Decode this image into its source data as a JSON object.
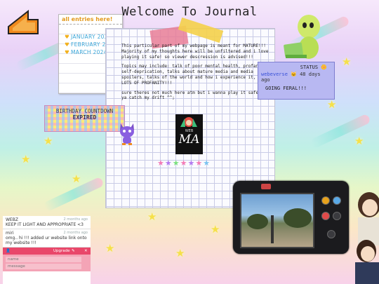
{
  "page": {
    "title": "Welcome To Journal"
  },
  "entries": {
    "heading": "all entries here!",
    "items": [
      "JANUARY 2024",
      "FEBRUARY 2024",
      "MARCH 2024"
    ]
  },
  "journal": {
    "paragraphs": [
      "This particular part of my webpage is meant for MATURE!!! Majority of my thoughts here will be unfiltered and i love playing it safe! so viewer descression is advised!!!",
      "Topics may include: talk of poor mental health, profanity, self-deprication, talks about mature media and media spoilers, talks of the world and how i experience it, and LOTS OF PROFANITY!!!",
      "sure theres not much here atm but i wanna play it safe if ya catch my drift ^^;"
    ]
  },
  "webma": {
    "small": "WEB",
    "big": "MA"
  },
  "birthday": {
    "line1": "BIRTHDAY COUNTDOWN",
    "line2": "EXPIRED"
  },
  "status": {
    "label": "STATUS",
    "user": "webeverse",
    "time": "48 days ago",
    "message": "GOING FERAL!!!"
  },
  "comments": {
    "items": [
      {
        "author": "WEBZ",
        "time": "2 months ago",
        "text": "KEEP IT LIGHT AND APPROPRIATE <3"
      },
      {
        "author": "miri",
        "time": "2 months ago",
        "text": "omg.. hi !!! added ur website link onto my website !!!"
      }
    ],
    "upgrade": "Upgrade",
    "name_placeholder": "name",
    "message_placeholder": "message"
  },
  "colors": {
    "status_bg": "#b8b8f2",
    "comment_bar": "#e9476a",
    "entry_link": "#3aa6d8"
  }
}
